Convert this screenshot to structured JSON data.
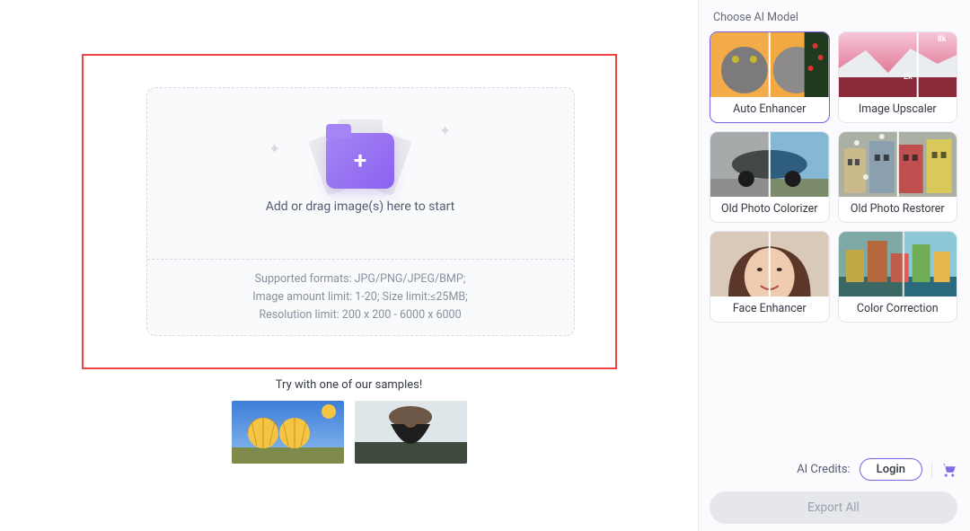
{
  "dropzone": {
    "prompt": "Add or drag image(s) here to start",
    "support_line1": "Supported formats: JPG/PNG/JPEG/BMP;",
    "support_line2": "Image amount limit: 1-20; Size limit:≤25MB;",
    "support_line3": "Resolution limit: 200 x 200 - 6000 x 6000"
  },
  "samples": {
    "label": "Try with one of our samples!"
  },
  "sidebar": {
    "title": "Choose AI Model",
    "models": [
      {
        "label": "Auto Enhancer",
        "selected": true
      },
      {
        "label": "Image Upscaler",
        "selected": false
      },
      {
        "label": "Old Photo Colorizer",
        "selected": false
      },
      {
        "label": "Old Photo Restorer",
        "selected": false
      },
      {
        "label": "Face Enhancer",
        "selected": false
      },
      {
        "label": "Color Correction",
        "selected": false
      }
    ],
    "upscaler_badges": {
      "top": "8k",
      "bottom": "2k"
    }
  },
  "bottom": {
    "credits_label": "AI Credits:",
    "login": "Login",
    "export": "Export All"
  }
}
